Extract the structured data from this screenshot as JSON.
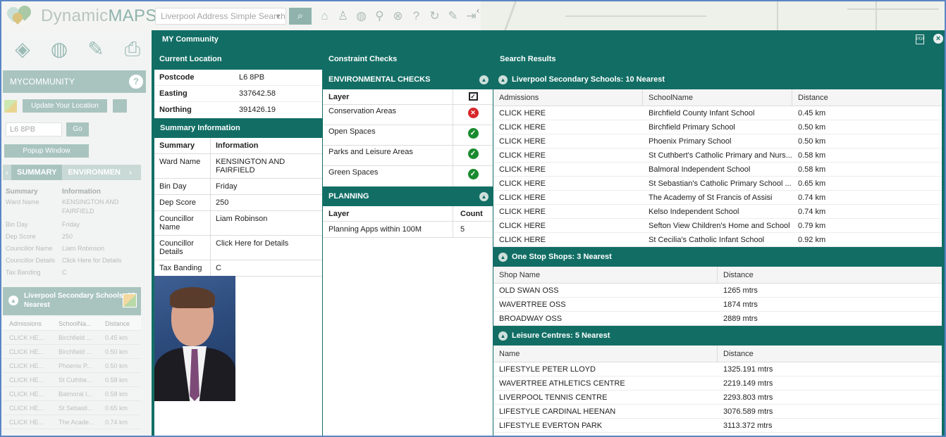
{
  "app": {
    "logo_text_a": "Dynamic",
    "logo_text_b": "MAPS"
  },
  "search": {
    "placeholder": "Liverpool Address Simple Search"
  },
  "sidebar": {
    "header": "MYCOMMUNITY",
    "update_btn": "Update Your Location",
    "postcode_value": "L6 8PB",
    "go_btn": "Go",
    "popup_btn": "Popup Window",
    "tabs": [
      "SUMMARY",
      "ENVIRONMEN"
    ],
    "summary_head": [
      "Summary",
      "Information"
    ],
    "summary_rows": [
      [
        "Ward Name",
        "KENSINGTON AND FAIRFIELD"
      ],
      [
        "Bin Day",
        "Friday"
      ],
      [
        "Dep Score",
        "250"
      ],
      [
        "Councillor Name",
        "Liam Robinson"
      ],
      [
        "Councillor Details",
        "Click Here for Details"
      ],
      [
        "Tax Banding",
        "C"
      ]
    ],
    "schools_title": "Liverpool Secondary Schools: 10 Nearest",
    "schools_head": [
      "Admissions",
      "SchoolNa...",
      "Distance"
    ],
    "schools_rows": [
      [
        "CLICK HE...",
        "Birchfield ...",
        "0.45 km"
      ],
      [
        "CLICK HE...",
        "Birchfield ...",
        "0.50 km"
      ],
      [
        "CLICK HE...",
        "Phoenix P...",
        "0.50 km"
      ],
      [
        "CLICK HE...",
        "St Cuthbe...",
        "0.58 km"
      ],
      [
        "CLICK HE...",
        "Balmoral I...",
        "0.58 km"
      ],
      [
        "CLICK HE...",
        "St Sebasti...",
        "0.65 km"
      ],
      [
        "CLICK HE...",
        "The Acade...",
        "0.74 km"
      ]
    ]
  },
  "modal": {
    "title": "MY Community",
    "current_location": {
      "heading": "Current Location",
      "postcode_label": "Postcode",
      "postcode": "L6 8PB",
      "easting_label": "Easting",
      "easting": "337642.58",
      "northing_label": "Northing",
      "northing": "391426.19"
    },
    "summary": {
      "heading": "Summary Information",
      "head": [
        "Summary",
        "Information"
      ],
      "rows": [
        [
          "Ward Name",
          "KENSINGTON AND FAIRFIELD"
        ],
        [
          "Bin Day",
          "Friday"
        ],
        [
          "Dep Score",
          "250"
        ],
        [
          "Councillor Name",
          "Liam Robinson"
        ],
        [
          "Councillor Details",
          "Click Here for Details"
        ],
        [
          "Tax Banding",
          "C"
        ]
      ]
    },
    "constraints": {
      "heading": "Constraint Checks",
      "env_heading": "ENVIRONMENTAL CHECKS",
      "env_layer_label": "Layer",
      "env_rows": [
        {
          "layer": "Conservation Areas",
          "status": "fail"
        },
        {
          "layer": "Open Spaces",
          "status": "pass"
        },
        {
          "layer": "Parks and Leisure Areas",
          "status": "pass"
        },
        {
          "layer": "Green Spaces",
          "status": "pass"
        }
      ],
      "planning_heading": "PLANNING",
      "planning_head": [
        "Layer",
        "Count"
      ],
      "planning_rows": [
        [
          "Planning Apps within 100M",
          "5"
        ]
      ]
    },
    "results": {
      "heading": "Search Results",
      "schools": {
        "title": "Liverpool Secondary Schools: 10 Nearest",
        "head": [
          "Admissions",
          "SchoolName",
          "Distance"
        ],
        "rows": [
          [
            "CLICK HERE",
            "Birchfield County Infant School",
            "0.45 km"
          ],
          [
            "CLICK HERE",
            "Birchfield Primary School",
            "0.50 km"
          ],
          [
            "CLICK HERE",
            "Phoenix Primary School",
            "0.50 km"
          ],
          [
            "CLICK HERE",
            "St Cuthbert's Catholic Primary and Nurs...",
            "0.58 km"
          ],
          [
            "CLICK HERE",
            "Balmoral Independent School",
            "0.58 km"
          ],
          [
            "CLICK HERE",
            "St Sebastian's Catholic Primary School ...",
            "0.65 km"
          ],
          [
            "CLICK HERE",
            "The Academy of St Francis of Assisi",
            "0.74 km"
          ],
          [
            "CLICK HERE",
            "Kelso Independent School",
            "0.74 km"
          ],
          [
            "CLICK HERE",
            "Sefton View Children's Home and School",
            "0.79 km"
          ],
          [
            "CLICK HERE",
            "St Cecilia's Catholic Infant School",
            "0.92 km"
          ]
        ]
      },
      "shops": {
        "title": "One Stop Shops: 3 Nearest",
        "head": [
          "Shop Name",
          "Distance"
        ],
        "rows": [
          [
            "OLD SWAN OSS",
            "1265 mtrs"
          ],
          [
            "WAVERTREE OSS",
            "1874 mtrs"
          ],
          [
            "BROADWAY OSS",
            "2889 mtrs"
          ]
        ]
      },
      "leisure": {
        "title": "Leisure Centres: 5 Nearest",
        "head": [
          "Name",
          "Distance"
        ],
        "rows": [
          [
            "LIFESTYLE PETER LLOYD",
            "1325.191 mtrs"
          ],
          [
            "WAVERTREE ATHLETICS CENTRE",
            "2219.149 mtrs"
          ],
          [
            "LIVERPOOL TENNIS CENTRE",
            "2293.803 mtrs"
          ],
          [
            "LIFESTYLE CARDINAL HEENAN",
            "3076.589 mtrs"
          ],
          [
            "LIFESTYLE EVERTON PARK",
            "3113.372 mtrs"
          ]
        ]
      }
    }
  },
  "icons": {
    "search": "search-icon",
    "home": "home-icon",
    "person": "person-icon",
    "globe": "globe-icon",
    "pin": "map-pin-icon",
    "clear": "clear-icon",
    "help": "help-icon",
    "refresh": "refresh-icon",
    "edit": "edit-icon",
    "logout": "logout-icon",
    "layers": "layers-icon",
    "print": "print-icon",
    "pdf": "pdf-icon",
    "close": "close-icon"
  },
  "colors": {
    "header_teal": "#126e65",
    "sidebar_teal": "#a9c4bf",
    "pass_green": "#1a8a2e",
    "fail_red": "#d7262a",
    "frame_blue": "#5a86c5"
  }
}
